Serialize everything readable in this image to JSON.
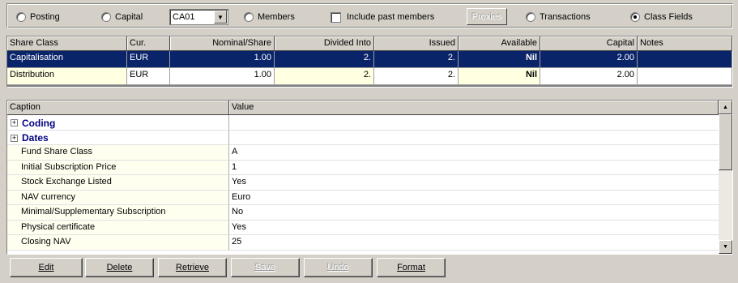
{
  "view_options": {
    "posting": {
      "label": "Posting",
      "selected": false
    },
    "capital": {
      "label": "Capital",
      "selected": false
    },
    "code_select": {
      "value": "CA01"
    },
    "members": {
      "label": "Members",
      "selected": false
    },
    "include_past_members": {
      "label": "Include past members",
      "checked": false
    },
    "proxies_label": "Proxies",
    "transactions": {
      "label": "Transactions",
      "selected": false
    },
    "class_fields": {
      "label": "Class Fields",
      "selected": true
    }
  },
  "share_grid": {
    "columns": [
      "Share Class",
      "Cur.",
      "Nominal/Share",
      "Divided Into",
      "Issued",
      "Available",
      "Capital",
      "Notes"
    ],
    "rows": [
      {
        "share_class": "Capitalisation",
        "currency": "EUR",
        "nominal": "1.00",
        "divided_into": "2.",
        "issued": "2.",
        "available": "Nil",
        "capital": "2.00",
        "notes": "",
        "selected": true
      },
      {
        "share_class": "Distribution",
        "currency": "EUR",
        "nominal": "1.00",
        "divided_into": "2.",
        "issued": "2.",
        "available": "Nil",
        "capital": "2.00",
        "notes": "",
        "selected": false
      }
    ]
  },
  "property_grid": {
    "caption_header": "Caption",
    "value_header": "Value",
    "categories": [
      {
        "label": "Coding",
        "expander": "+"
      },
      {
        "label": "Dates",
        "expander": "+"
      }
    ],
    "rows": [
      {
        "caption": "Fund Share Class",
        "value": "A"
      },
      {
        "caption": "Initial Subscription Price",
        "value": "1"
      },
      {
        "caption": "Stock Exchange Listed",
        "value": "Yes"
      },
      {
        "caption": "NAV currency",
        "value": "Euro"
      },
      {
        "caption": "Minimal/Supplementary Subscription",
        "value": "No"
      },
      {
        "caption": "Physical certificate",
        "value": "Yes"
      },
      {
        "caption": "Closing NAV",
        "value": "25"
      }
    ]
  },
  "buttons": {
    "edit": "Edit",
    "delete": "Delete",
    "retrieve": "Retrieve",
    "save": "Save",
    "undo": "Undo",
    "format": "Format"
  }
}
